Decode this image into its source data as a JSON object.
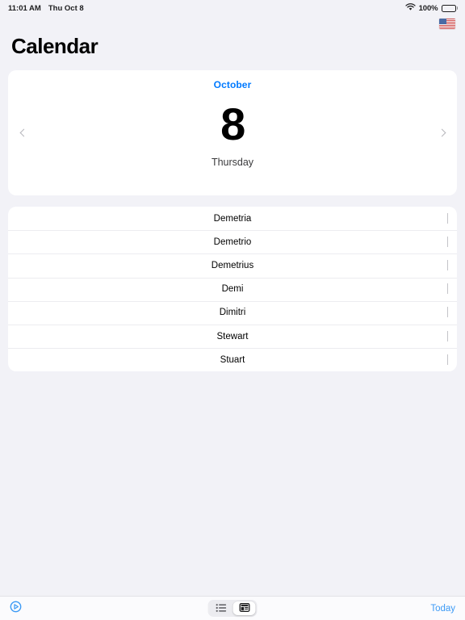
{
  "status_bar": {
    "time": "11:01 AM",
    "date": "Thu Oct 8",
    "wifi_icon": "wifi-icon",
    "battery_percent": "100%",
    "battery_icon": "battery-full-icon"
  },
  "locale_indicator": {
    "icon": "us-flag-icon",
    "label": "United States"
  },
  "header": {
    "title": "Calendar"
  },
  "date_card": {
    "month": "October",
    "day": "8",
    "weekday": "Thursday",
    "prev_icon": "chevron-left-icon",
    "next_icon": "chevron-right-icon",
    "accent_color": "#007aff"
  },
  "results": {
    "rows": [
      {
        "label": "Demetria",
        "chevron": "chevron-right-icon"
      },
      {
        "label": "Demetrio",
        "chevron": "chevron-right-icon"
      },
      {
        "label": "Demetrius",
        "chevron": "chevron-right-icon"
      },
      {
        "label": "Demi",
        "chevron": "chevron-right-icon"
      },
      {
        "label": "Dimitri",
        "chevron": "chevron-right-icon"
      },
      {
        "label": "Stewart",
        "chevron": "chevron-right-icon"
      },
      {
        "label": "Stuart",
        "chevron": "chevron-right-icon"
      }
    ]
  },
  "toolbar": {
    "left_icon": "play-circle-icon",
    "left_icon_color": "#3c9af5",
    "segmented": {
      "options": [
        {
          "icon": "list-view-icon",
          "selected": false
        },
        {
          "icon": "card-view-icon",
          "selected": true
        }
      ]
    },
    "today_label": "Today",
    "today_color": "#3c9af5"
  }
}
